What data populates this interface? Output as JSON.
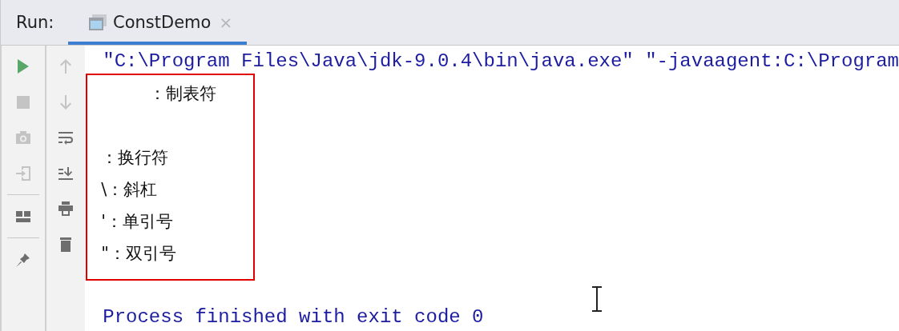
{
  "panel": {
    "label": "Run:"
  },
  "tabs": [
    {
      "label": "ConstDemo",
      "selected": true,
      "close": "×"
    }
  ],
  "console": {
    "command": "\"C:\\Program Files\\Java\\jdk-9.0.4\\bin\\java.exe\" \"-javaagent:C:\\Program",
    "output": [
      "\t：制表符",
      "\n：换行符",
      "\\：斜杠",
      "'：单引号",
      "\"：双引号"
    ],
    "exit_message": "Process finished with exit code 0"
  }
}
